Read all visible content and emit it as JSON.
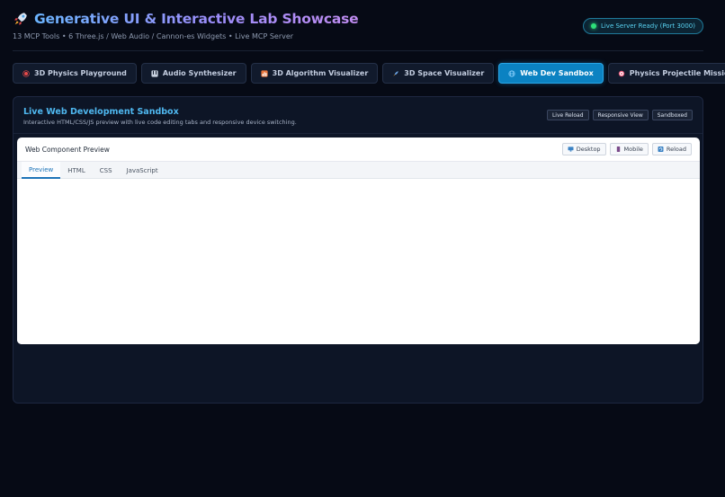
{
  "header": {
    "title": "Generative UI & Interactive Lab Showcase",
    "subtitle": "13 MCP Tools • 6 Three.js / Web Audio / Cannon-es Widgets • Live MCP Server",
    "status": "Live Server Ready (Port 3000)"
  },
  "tabs": [
    {
      "label": "3D Physics Playground",
      "icon": "physics-icon",
      "color": "#e64a4a"
    },
    {
      "label": "Audio Synthesizer",
      "icon": "synth-icon",
      "color": "#c9d2e0"
    },
    {
      "label": "3D Algorithm Visualizer",
      "icon": "chart-icon",
      "color": "#e8743b"
    },
    {
      "label": "3D Space Visualizer",
      "icon": "rocket-icon",
      "color": "#6fa8e8"
    },
    {
      "label": "Web Dev Sandbox",
      "icon": "globe-icon",
      "color": "#8fd3ff",
      "active": true
    },
    {
      "label": "Physics Projectile Mission",
      "icon": "target-icon",
      "color": "#e85a7a"
    }
  ],
  "panel": {
    "title": "Live Web Development Sandbox",
    "description": "Interactive HTML/CSS/JS preview with live code editing tabs and responsive device switching.",
    "badges": [
      "Live Reload",
      "Responsive View",
      "Sandboxed"
    ]
  },
  "preview": {
    "title": "Web Component Preview",
    "device_buttons": [
      {
        "label": "Desktop",
        "icon": "desktop-icon",
        "color": "#3b82c4"
      },
      {
        "label": "Mobile",
        "icon": "mobile-icon",
        "color": "#7a4a8a"
      },
      {
        "label": "Reload",
        "icon": "reload-icon",
        "color": "#3b82c4"
      }
    ],
    "code_tabs": [
      "Preview",
      "HTML",
      "CSS",
      "JavaScript"
    ],
    "active_code_tab": "Preview"
  },
  "colors": {
    "background": "#060a15",
    "accent": "#0b82c2",
    "status_green": "#2ee07a"
  }
}
